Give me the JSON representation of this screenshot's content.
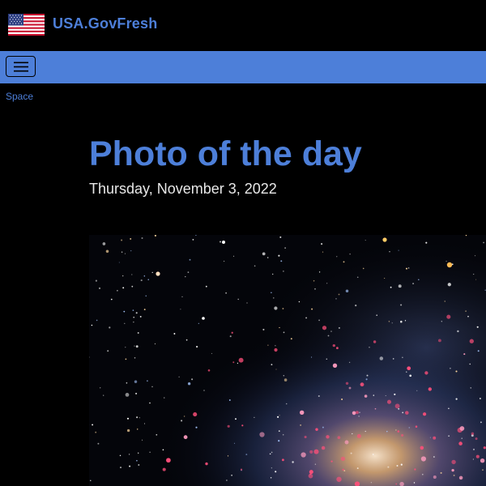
{
  "header": {
    "site_title": "USA.GovFresh",
    "flag_icon": "us-flag-icon",
    "colors": {
      "background": "#000000",
      "accent": "#4d7fd9"
    }
  },
  "navbar": {
    "menu_icon": "hamburger-menu-icon",
    "color": "#4d7fd9"
  },
  "breadcrumb": {
    "label": "Space"
  },
  "main": {
    "title": "Photo of the day",
    "date": "Thursday, November 3, 2022",
    "photo": {
      "subject": "spiral-galaxy-image",
      "alt": ""
    }
  }
}
